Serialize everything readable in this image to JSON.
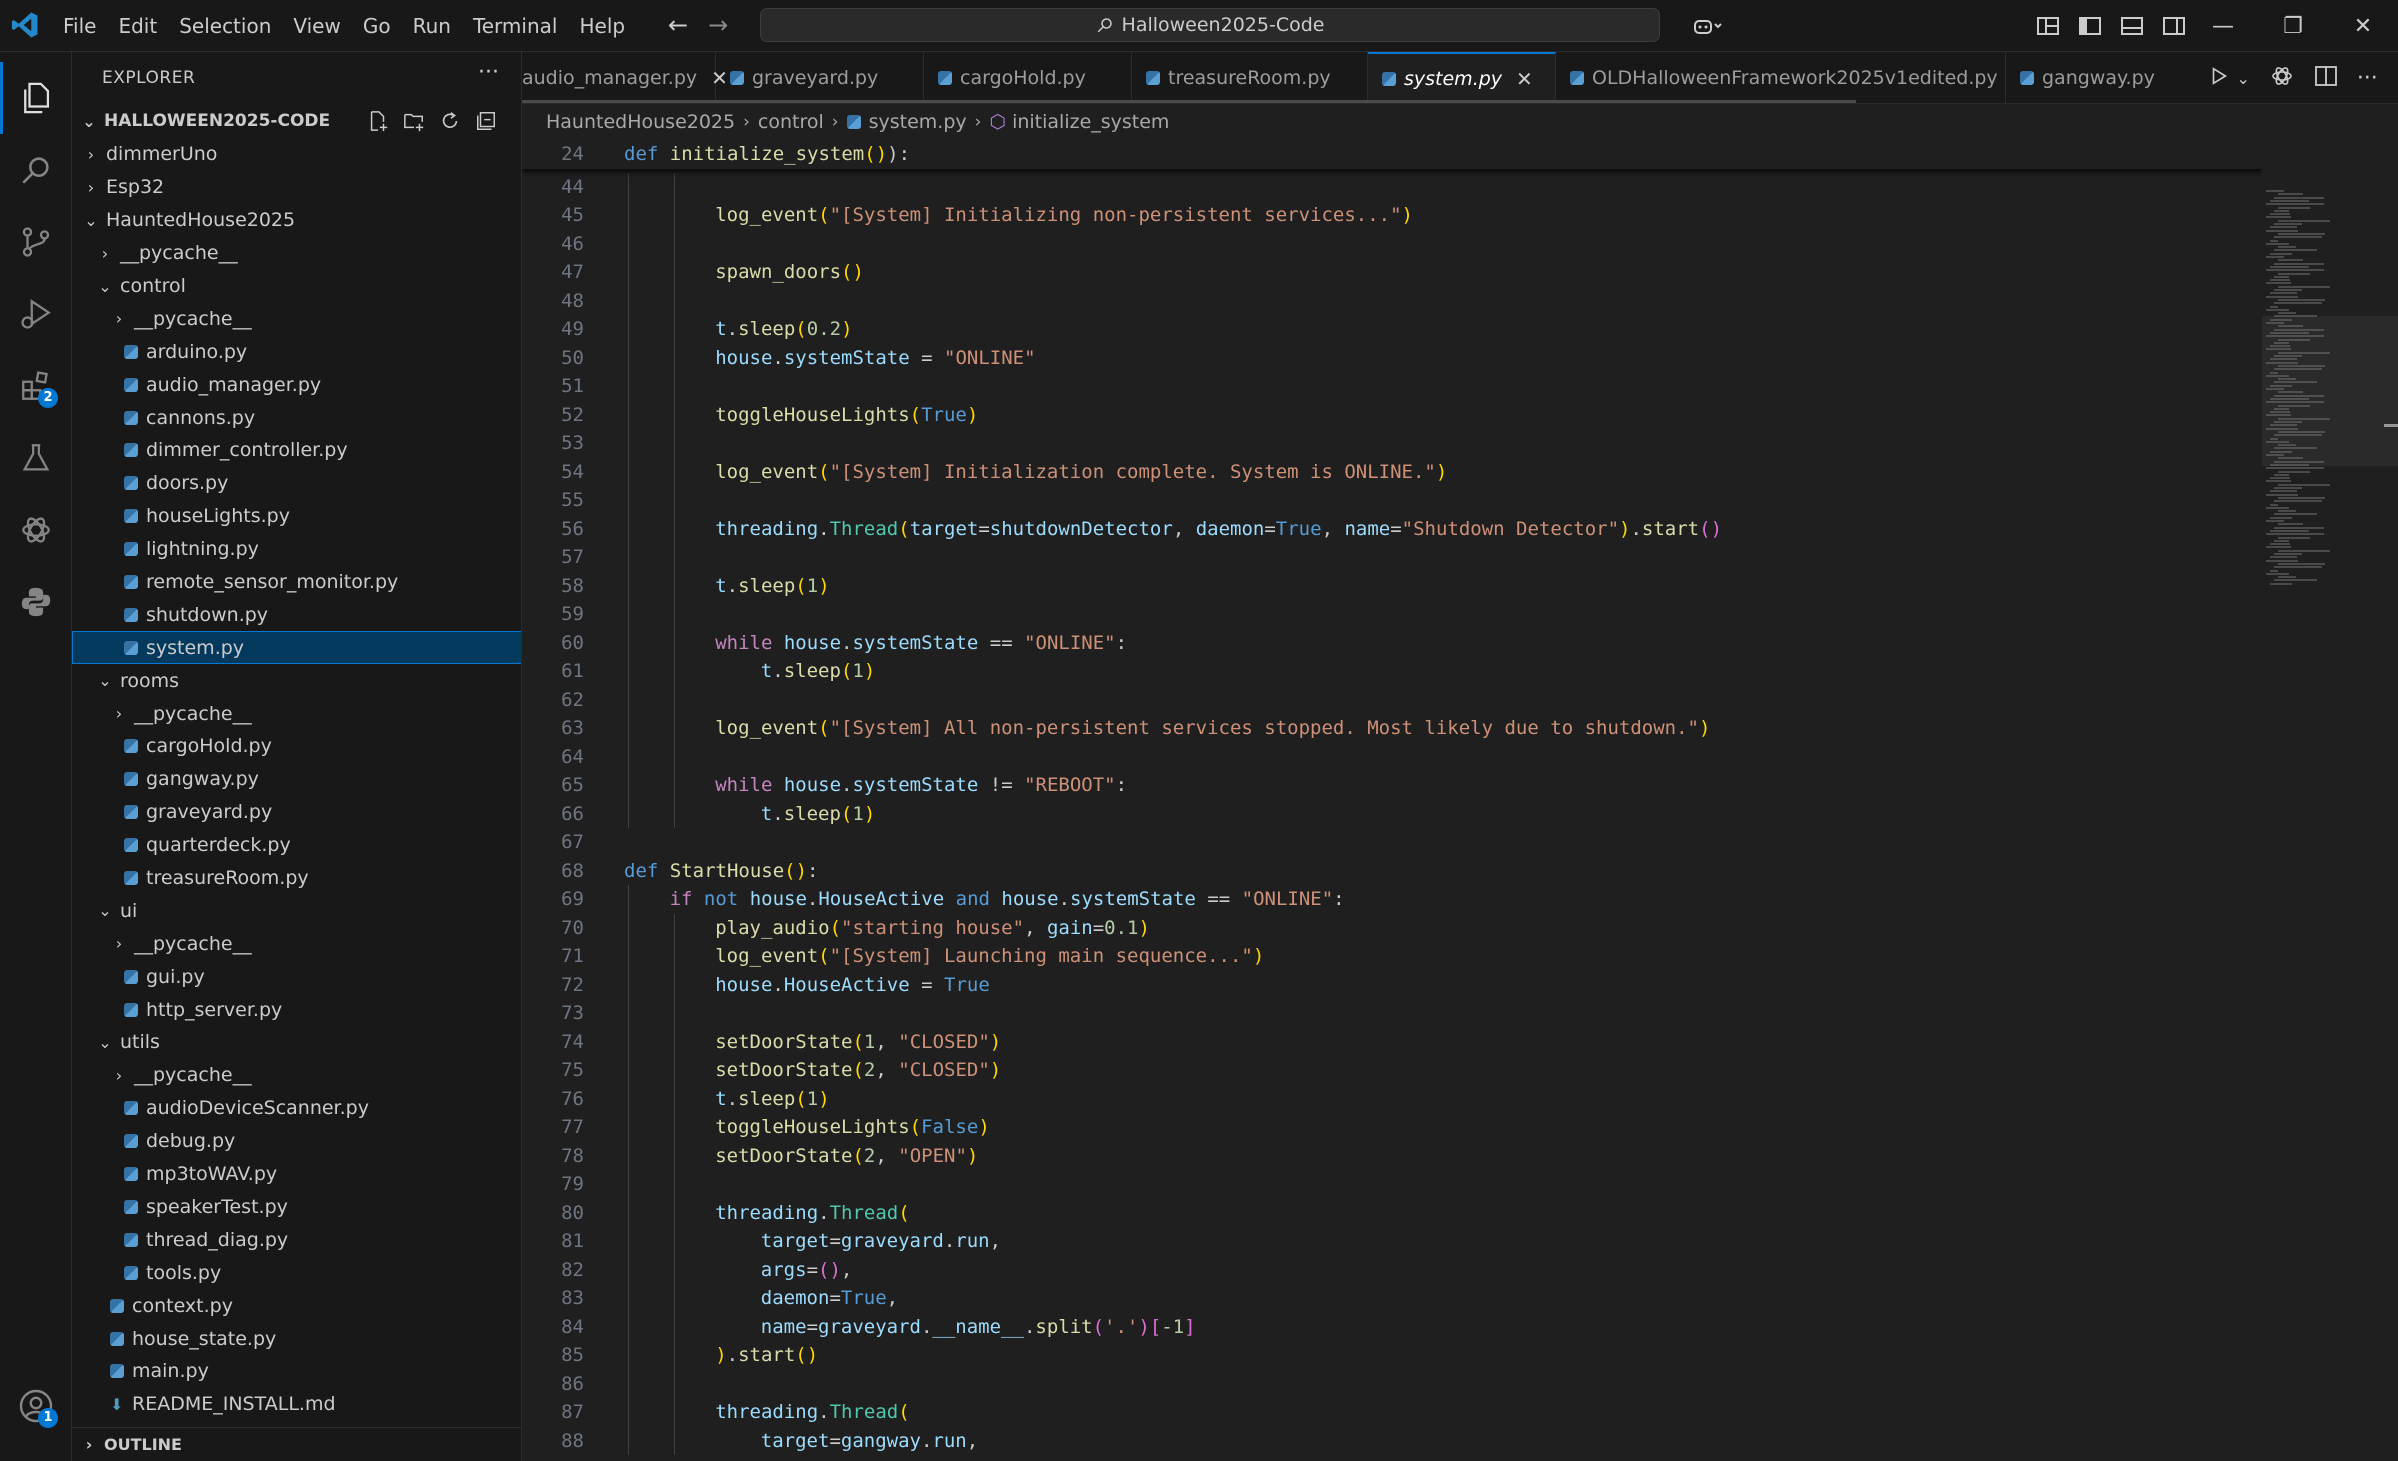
{
  "titlebar": {
    "menu": [
      "File",
      "Edit",
      "Selection",
      "View",
      "Go",
      "Run",
      "Terminal",
      "Help"
    ],
    "search": "Halloween2025-Code"
  },
  "activity_bar": {
    "items": [
      "explorer-icon",
      "search-icon",
      "source-control-icon",
      "run-debug-icon",
      "extensions-icon",
      "testing-icon",
      "chatgpt-icon",
      "python-icon"
    ],
    "extensions_badge": "2",
    "accounts_badge": "1"
  },
  "sidebar": {
    "header": "EXPLORER",
    "section": "HALLOWEEN2025-CODE",
    "outline": "OUTLINE",
    "tree": [
      {
        "label": "dimmerUno",
        "type": "folder",
        "depth": 1,
        "open": false
      },
      {
        "label": "Esp32",
        "type": "folder",
        "depth": 1,
        "open": false
      },
      {
        "label": "HauntedHouse2025",
        "type": "folder",
        "depth": 1,
        "open": true
      },
      {
        "label": "__pycache__",
        "type": "folder",
        "depth": 2,
        "open": false
      },
      {
        "label": "control",
        "type": "folder",
        "depth": 2,
        "open": true
      },
      {
        "label": "__pycache__",
        "type": "folder",
        "depth": 3,
        "open": false
      },
      {
        "label": "arduino.py",
        "type": "py",
        "depth": 3
      },
      {
        "label": "audio_manager.py",
        "type": "py",
        "depth": 3
      },
      {
        "label": "cannons.py",
        "type": "py",
        "depth": 3
      },
      {
        "label": "dimmer_controller.py",
        "type": "py",
        "depth": 3
      },
      {
        "label": "doors.py",
        "type": "py",
        "depth": 3
      },
      {
        "label": "houseLights.py",
        "type": "py",
        "depth": 3
      },
      {
        "label": "lightning.py",
        "type": "py",
        "depth": 3
      },
      {
        "label": "remote_sensor_monitor.py",
        "type": "py",
        "depth": 3
      },
      {
        "label": "shutdown.py",
        "type": "py",
        "depth": 3
      },
      {
        "label": "system.py",
        "type": "py",
        "depth": 3,
        "selected": true
      },
      {
        "label": "rooms",
        "type": "folder",
        "depth": 2,
        "open": true
      },
      {
        "label": "__pycache__",
        "type": "folder",
        "depth": 3,
        "open": false
      },
      {
        "label": "cargoHold.py",
        "type": "py",
        "depth": 3
      },
      {
        "label": "gangway.py",
        "type": "py",
        "depth": 3
      },
      {
        "label": "graveyard.py",
        "type": "py",
        "depth": 3
      },
      {
        "label": "quarterdeck.py",
        "type": "py",
        "depth": 3
      },
      {
        "label": "treasureRoom.py",
        "type": "py",
        "depth": 3
      },
      {
        "label": "ui",
        "type": "folder",
        "depth": 2,
        "open": true
      },
      {
        "label": "__pycache__",
        "type": "folder",
        "depth": 3,
        "open": false
      },
      {
        "label": "gui.py",
        "type": "py",
        "depth": 3
      },
      {
        "label": "http_server.py",
        "type": "py",
        "depth": 3
      },
      {
        "label": "utils",
        "type": "folder",
        "depth": 2,
        "open": true
      },
      {
        "label": "__pycache__",
        "type": "folder",
        "depth": 3,
        "open": false
      },
      {
        "label": "audioDeviceScanner.py",
        "type": "py",
        "depth": 3
      },
      {
        "label": "debug.py",
        "type": "py",
        "depth": 3
      },
      {
        "label": "mp3toWAV.py",
        "type": "py",
        "depth": 3
      },
      {
        "label": "speakerTest.py",
        "type": "py",
        "depth": 3
      },
      {
        "label": "thread_diag.py",
        "type": "py",
        "depth": 3
      },
      {
        "label": "tools.py",
        "type": "py",
        "depth": 3
      },
      {
        "label": "context.py",
        "type": "py",
        "depth": 2
      },
      {
        "label": "house_state.py",
        "type": "py",
        "depth": 2
      },
      {
        "label": "main.py",
        "type": "py",
        "depth": 2
      },
      {
        "label": "README_INSTALL.md",
        "type": "md",
        "depth": 2
      }
    ]
  },
  "tabs": [
    {
      "label": "audio_manager.py",
      "active": false,
      "close": true
    },
    {
      "label": "graveyard.py",
      "active": false
    },
    {
      "label": "cargoHold.py",
      "active": false
    },
    {
      "label": "treasureRoom.py",
      "active": false
    },
    {
      "label": "system.py",
      "active": true,
      "close": true
    },
    {
      "label": "OLDHalloweenFramework2025v1edited.py",
      "active": false
    },
    {
      "label": "gangway.py",
      "active": false
    }
  ],
  "breadcrumbs": [
    "HauntedHouse2025",
    "control",
    "system.py",
    "initialize_system"
  ],
  "sticky_line": {
    "num": "24",
    "tokens": [
      [
        "kw",
        "def "
      ],
      [
        "fn",
        "initialize_system"
      ],
      [
        "pn",
        "("
      ],
      [
        "pn",
        ")"
      ],
      [
        "",
        "):"
      ]
    ]
  },
  "code_lines": [
    {
      "num": "44",
      "indent": 2,
      "tokens": []
    },
    {
      "num": "45",
      "indent": 2,
      "tokens": [
        [
          "fn",
          "log_event"
        ],
        [
          "pn",
          "("
        ],
        [
          "st",
          "\"[System] Initializing non-persistent services...\""
        ],
        [
          "pn",
          ")"
        ]
      ]
    },
    {
      "num": "46",
      "indent": 2,
      "tokens": []
    },
    {
      "num": "47",
      "indent": 2,
      "tokens": [
        [
          "fn",
          "spawn_doors"
        ],
        [
          "pn",
          "()"
        ]
      ]
    },
    {
      "num": "48",
      "indent": 2,
      "tokens": []
    },
    {
      "num": "49",
      "indent": 2,
      "tokens": [
        [
          "va",
          "t"
        ],
        [
          "",
          "."
        ],
        [
          "fn",
          "sleep"
        ],
        [
          "pn",
          "("
        ],
        [
          "nu",
          "0.2"
        ],
        [
          "pn",
          ")"
        ]
      ]
    },
    {
      "num": "50",
      "indent": 2,
      "tokens": [
        [
          "va",
          "house"
        ],
        [
          "",
          "."
        ],
        [
          "va",
          "systemState"
        ],
        [
          "",
          " = "
        ],
        [
          "st",
          "\"ONLINE\""
        ]
      ]
    },
    {
      "num": "51",
      "indent": 2,
      "tokens": []
    },
    {
      "num": "52",
      "indent": 2,
      "tokens": [
        [
          "fn",
          "toggleHouseLights"
        ],
        [
          "pn",
          "("
        ],
        [
          "kw",
          "True"
        ],
        [
          "pn",
          ")"
        ]
      ]
    },
    {
      "num": "53",
      "indent": 2,
      "tokens": []
    },
    {
      "num": "54",
      "indent": 2,
      "tokens": [
        [
          "fn",
          "log_event"
        ],
        [
          "pn",
          "("
        ],
        [
          "st",
          "\"[System] Initialization complete. System is ONLINE.\""
        ],
        [
          "pn",
          ")"
        ]
      ]
    },
    {
      "num": "55",
      "indent": 2,
      "tokens": []
    },
    {
      "num": "56",
      "indent": 2,
      "tokens": [
        [
          "va",
          "threading"
        ],
        [
          "",
          "."
        ],
        [
          "cl",
          "Thread"
        ],
        [
          "pn",
          "("
        ],
        [
          "va",
          "target"
        ],
        [
          "",
          "="
        ],
        [
          "va",
          "shutdownDetector"
        ],
        [
          "",
          ", "
        ],
        [
          "va",
          "daemon"
        ],
        [
          "",
          "="
        ],
        [
          "kw",
          "True"
        ],
        [
          "",
          ", "
        ],
        [
          "va",
          "name"
        ],
        [
          "",
          "="
        ],
        [
          "st",
          "\"Shutdown Detector\""
        ],
        [
          "pn",
          ")"
        ],
        [
          "",
          "."
        ],
        [
          "fn",
          "start"
        ],
        [
          "pn2",
          "()"
        ]
      ]
    },
    {
      "num": "57",
      "indent": 2,
      "tokens": []
    },
    {
      "num": "58",
      "indent": 2,
      "tokens": [
        [
          "va",
          "t"
        ],
        [
          "",
          "."
        ],
        [
          "fn",
          "sleep"
        ],
        [
          "pn",
          "("
        ],
        [
          "nu",
          "1"
        ],
        [
          "pn",
          ")"
        ]
      ]
    },
    {
      "num": "59",
      "indent": 2,
      "tokens": []
    },
    {
      "num": "60",
      "indent": 2,
      "tokens": [
        [
          "ct2",
          "while "
        ],
        [
          "va",
          "house"
        ],
        [
          "",
          "."
        ],
        [
          "va",
          "systemState"
        ],
        [
          "",
          " == "
        ],
        [
          "st",
          "\"ONLINE\""
        ],
        [
          "",
          ":"
        ]
      ]
    },
    {
      "num": "61",
      "indent": 3,
      "tokens": [
        [
          "va",
          "t"
        ],
        [
          "",
          "."
        ],
        [
          "fn",
          "sleep"
        ],
        [
          "pn",
          "("
        ],
        [
          "nu",
          "1"
        ],
        [
          "pn",
          ")"
        ]
      ]
    },
    {
      "num": "62",
      "indent": 2,
      "tokens": []
    },
    {
      "num": "63",
      "indent": 2,
      "tokens": [
        [
          "fn",
          "log_event"
        ],
        [
          "pn",
          "("
        ],
        [
          "st",
          "\"[System] All non-persistent services stopped. Most likely due to shutdown.\""
        ],
        [
          "pn",
          ")"
        ]
      ]
    },
    {
      "num": "64",
      "indent": 2,
      "tokens": []
    },
    {
      "num": "65",
      "indent": 2,
      "tokens": [
        [
          "ct2",
          "while "
        ],
        [
          "va",
          "house"
        ],
        [
          "",
          "."
        ],
        [
          "va",
          "systemState"
        ],
        [
          "",
          " != "
        ],
        [
          "st",
          "\"REBOOT\""
        ],
        [
          "",
          ":"
        ]
      ]
    },
    {
      "num": "66",
      "indent": 3,
      "tokens": [
        [
          "va",
          "t"
        ],
        [
          "",
          "."
        ],
        [
          "fn",
          "sleep"
        ],
        [
          "pn",
          "("
        ],
        [
          "nu",
          "1"
        ],
        [
          "pn",
          ")"
        ]
      ]
    },
    {
      "num": "67",
      "indent": 0,
      "tokens": []
    },
    {
      "num": "68",
      "indent": 0,
      "tokens": [
        [
          "kw",
          "def "
        ],
        [
          "fn",
          "StartHouse"
        ],
        [
          "pn",
          "()"
        ],
        [
          "",
          ":"
        ]
      ]
    },
    {
      "num": "69",
      "indent": 1,
      "tokens": [
        [
          "ct2",
          "if "
        ],
        [
          "kw",
          "not "
        ],
        [
          "va",
          "house"
        ],
        [
          "",
          "."
        ],
        [
          "va",
          "HouseActive"
        ],
        [
          "kw",
          " and "
        ],
        [
          "va",
          "house"
        ],
        [
          "",
          "."
        ],
        [
          "va",
          "systemState"
        ],
        [
          "",
          " == "
        ],
        [
          "st",
          "\"ONLINE\""
        ],
        [
          "",
          ":"
        ]
      ]
    },
    {
      "num": "70",
      "indent": 2,
      "tokens": [
        [
          "fn",
          "play_audio"
        ],
        [
          "pn",
          "("
        ],
        [
          "st",
          "\"starting house\""
        ],
        [
          "",
          ", "
        ],
        [
          "va",
          "gain"
        ],
        [
          "",
          "="
        ],
        [
          "nu",
          "0.1"
        ],
        [
          "pn",
          ")"
        ]
      ]
    },
    {
      "num": "71",
      "indent": 2,
      "tokens": [
        [
          "fn",
          "log_event"
        ],
        [
          "pn",
          "("
        ],
        [
          "st",
          "\"[System] Launching main sequence...\""
        ],
        [
          "pn",
          ")"
        ]
      ]
    },
    {
      "num": "72",
      "indent": 2,
      "tokens": [
        [
          "va",
          "house"
        ],
        [
          "",
          "."
        ],
        [
          "va",
          "HouseActive"
        ],
        [
          "",
          " = "
        ],
        [
          "kw",
          "True"
        ]
      ]
    },
    {
      "num": "73",
      "indent": 2,
      "tokens": []
    },
    {
      "num": "74",
      "indent": 2,
      "tokens": [
        [
          "fn",
          "setDoorState"
        ],
        [
          "pn",
          "("
        ],
        [
          "nu",
          "1"
        ],
        [
          "",
          ", "
        ],
        [
          "st",
          "\"CLOSED\""
        ],
        [
          "pn",
          ")"
        ]
      ]
    },
    {
      "num": "75",
      "indent": 2,
      "tokens": [
        [
          "fn",
          "setDoorState"
        ],
        [
          "pn",
          "("
        ],
        [
          "nu",
          "2"
        ],
        [
          "",
          ", "
        ],
        [
          "st",
          "\"CLOSED\""
        ],
        [
          "pn",
          ")"
        ]
      ]
    },
    {
      "num": "76",
      "indent": 2,
      "tokens": [
        [
          "va",
          "t"
        ],
        [
          "",
          "."
        ],
        [
          "fn",
          "sleep"
        ],
        [
          "pn",
          "("
        ],
        [
          "nu",
          "1"
        ],
        [
          "pn",
          ")"
        ]
      ]
    },
    {
      "num": "77",
      "indent": 2,
      "tokens": [
        [
          "fn",
          "toggleHouseLights"
        ],
        [
          "pn",
          "("
        ],
        [
          "kw",
          "False"
        ],
        [
          "pn",
          ")"
        ]
      ]
    },
    {
      "num": "78",
      "indent": 2,
      "tokens": [
        [
          "fn",
          "setDoorState"
        ],
        [
          "pn",
          "("
        ],
        [
          "nu",
          "2"
        ],
        [
          "",
          ", "
        ],
        [
          "st",
          "\"OPEN\""
        ],
        [
          "pn",
          ")"
        ]
      ]
    },
    {
      "num": "79",
      "indent": 2,
      "tokens": []
    },
    {
      "num": "80",
      "indent": 2,
      "tokens": [
        [
          "va",
          "threading"
        ],
        [
          "",
          "."
        ],
        [
          "cl",
          "Thread"
        ],
        [
          "pn",
          "("
        ]
      ]
    },
    {
      "num": "81",
      "indent": 3,
      "tokens": [
        [
          "va",
          "target"
        ],
        [
          "",
          "="
        ],
        [
          "va",
          "graveyard"
        ],
        [
          "",
          "."
        ],
        [
          "va",
          "run"
        ],
        [
          "",
          ","
        ]
      ]
    },
    {
      "num": "82",
      "indent": 3,
      "tokens": [
        [
          "va",
          "args"
        ],
        [
          "",
          "="
        ],
        [
          "pn2",
          "()"
        ],
        [
          "",
          ","
        ]
      ]
    },
    {
      "num": "83",
      "indent": 3,
      "tokens": [
        [
          "va",
          "daemon"
        ],
        [
          "",
          "="
        ],
        [
          "kw",
          "True"
        ],
        [
          "",
          ","
        ]
      ]
    },
    {
      "num": "84",
      "indent": 3,
      "tokens": [
        [
          "va",
          "name"
        ],
        [
          "",
          "="
        ],
        [
          "va",
          "graveyard"
        ],
        [
          "",
          "."
        ],
        [
          "va",
          "__name__"
        ],
        [
          "",
          "."
        ],
        [
          "fn",
          "split"
        ],
        [
          "pn2",
          "("
        ],
        [
          "st",
          "'.'"
        ],
        [
          "pn2",
          ")"
        ],
        [
          "pn2",
          "["
        ],
        [
          "nu",
          "-1"
        ],
        [
          "pn2",
          "]"
        ]
      ]
    },
    {
      "num": "85",
      "indent": 2,
      "tokens": [
        [
          "pn",
          ")"
        ],
        [
          "",
          "."
        ],
        [
          "fn",
          "start"
        ],
        [
          "pn",
          "()"
        ]
      ]
    },
    {
      "num": "86",
      "indent": 2,
      "tokens": []
    },
    {
      "num": "87",
      "indent": 2,
      "tokens": [
        [
          "va",
          "threading"
        ],
        [
          "",
          "."
        ],
        [
          "cl",
          "Thread"
        ],
        [
          "pn",
          "("
        ]
      ]
    },
    {
      "num": "88",
      "indent": 3,
      "tokens": [
        [
          "va",
          "target"
        ],
        [
          "",
          "="
        ],
        [
          "va",
          "gangway"
        ],
        [
          "",
          "."
        ],
        [
          "va",
          "run"
        ],
        [
          "",
          ","
        ]
      ]
    }
  ]
}
